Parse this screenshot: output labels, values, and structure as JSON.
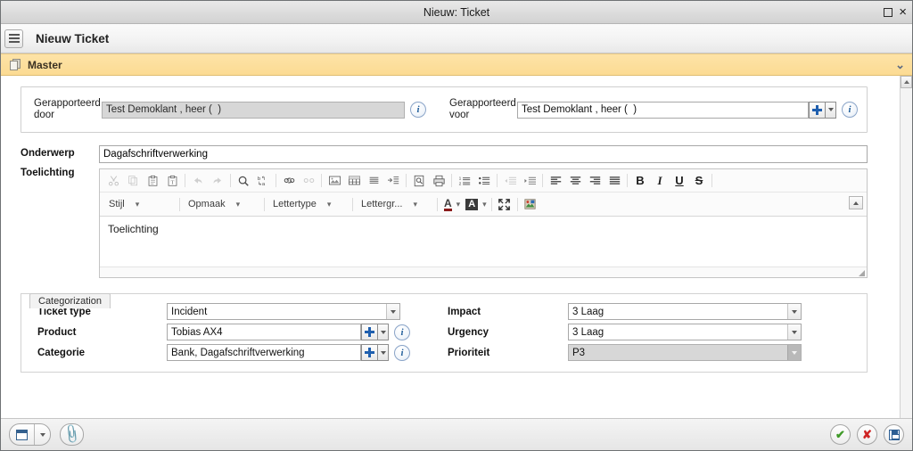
{
  "window": {
    "title": "Nieuw: Ticket",
    "maximize_label": "Maximize",
    "close_label": "×"
  },
  "header": {
    "menu_label": "Menu",
    "title": "Nieuw Ticket"
  },
  "master_section": {
    "label": "Master",
    "icon": "document-icon",
    "chevron": "⌄"
  },
  "reporter": {
    "by": {
      "label_line1": "Gerapporteerd",
      "label_line2": "door",
      "value": "Test Demoklant , heer (  )",
      "disabled": true,
      "info_label": "i"
    },
    "for": {
      "label_line1": "Gerapporteerd",
      "label_line2": "voor",
      "value": "Test Demoklant , heer (  )",
      "disabled": false,
      "info_label": "i"
    }
  },
  "subject": {
    "label": "Onderwerp",
    "value": "Dagafschriftverwerking"
  },
  "description": {
    "label": "Toelichting",
    "body_text": "Toelichting",
    "toolbar_row1": [
      {
        "name": "cut-icon",
        "glyph": "✂",
        "disabled": true
      },
      {
        "name": "copy-icon",
        "glyph": "⧉",
        "disabled": true
      },
      {
        "name": "paste-icon",
        "glyph": "📋",
        "disabled": false
      },
      {
        "name": "paste-from-word-icon",
        "glyph": "📋",
        "disabled": false
      },
      {
        "name": "separator",
        "glyph": "|",
        "disabled": false
      },
      {
        "name": "undo-icon",
        "glyph": "↩",
        "disabled": true
      },
      {
        "name": "redo-icon",
        "glyph": "↪",
        "disabled": true
      },
      {
        "name": "separator",
        "glyph": "|",
        "disabled": false
      },
      {
        "name": "find-icon",
        "glyph": "🔍",
        "disabled": false
      },
      {
        "name": "replace-icon",
        "glyph": "ab",
        "disabled": false
      },
      {
        "name": "separator",
        "glyph": "|",
        "disabled": false
      },
      {
        "name": "link-icon",
        "glyph": "🔗",
        "disabled": false
      },
      {
        "name": "unlink-icon",
        "glyph": "🔗",
        "disabled": true
      },
      {
        "name": "separator",
        "glyph": "|",
        "disabled": false
      },
      {
        "name": "image-icon",
        "glyph": "🖼",
        "disabled": false
      },
      {
        "name": "table-icon",
        "glyph": "▦",
        "disabled": false
      },
      {
        "name": "horizontal-rule-icon",
        "glyph": "▤",
        "disabled": false
      },
      {
        "name": "page-break-icon",
        "glyph": "⇥",
        "disabled": false
      },
      {
        "name": "separator",
        "glyph": "|",
        "disabled": false
      },
      {
        "name": "preview-icon",
        "glyph": "🗎",
        "disabled": false
      },
      {
        "name": "print-icon",
        "glyph": "🖶",
        "disabled": false
      },
      {
        "name": "separator",
        "glyph": "|",
        "disabled": false
      },
      {
        "name": "numbered-list-icon",
        "glyph": "1≡",
        "disabled": false
      },
      {
        "name": "bulleted-list-icon",
        "glyph": "•≡",
        "disabled": false
      },
      {
        "name": "separator",
        "glyph": "|",
        "disabled": false
      },
      {
        "name": "decrease-indent-icon",
        "glyph": "⇤",
        "disabled": true
      },
      {
        "name": "increase-indent-icon",
        "glyph": "⇥",
        "disabled": false
      },
      {
        "name": "separator",
        "glyph": "|",
        "disabled": false
      },
      {
        "name": "align-left-icon",
        "glyph": "≡",
        "disabled": false
      },
      {
        "name": "align-center-icon",
        "glyph": "≡",
        "disabled": false
      },
      {
        "name": "align-right-icon",
        "glyph": "≡",
        "disabled": false
      },
      {
        "name": "justify-icon",
        "glyph": "≡",
        "disabled": false
      },
      {
        "name": "separator",
        "glyph": "|",
        "disabled": false
      },
      {
        "name": "bold-icon",
        "glyph": "B",
        "disabled": false
      },
      {
        "name": "italic-icon",
        "glyph": "I",
        "disabled": false
      },
      {
        "name": "underline-icon",
        "glyph": "U",
        "disabled": false
      },
      {
        "name": "strikethrough-icon",
        "glyph": "S",
        "disabled": false
      }
    ],
    "toolbar_row2": {
      "style_dropdown": "Stijl",
      "format_dropdown": "Opmaak",
      "fontname_dropdown": "Lettertype",
      "fontsize_dropdown": "Lettergr...",
      "text_color_label": "A",
      "bg_color_label": "A",
      "maximize_label": "maximize-editor-icon",
      "emoticon_label": "image-button-icon",
      "collapse_toolbar_label": "collapse-toolbar-icon"
    }
  },
  "categorization": {
    "tab_label": "Categorization",
    "left_fields": [
      {
        "label": "Ticket type",
        "value": "Incident",
        "type": "select",
        "disabled": false,
        "has_buttons": false
      },
      {
        "label": "Product",
        "value": "Tobias AX4",
        "type": "lookup",
        "disabled": false,
        "has_buttons": true
      },
      {
        "label": "Categorie",
        "value": "Bank, Dagafschriftverwerking",
        "type": "lookup",
        "disabled": false,
        "has_buttons": true
      }
    ],
    "right_fields": [
      {
        "label": "Impact",
        "value": "3 Laag",
        "type": "select",
        "disabled": false
      },
      {
        "label": "Urgency",
        "value": "3 Laag",
        "type": "select",
        "disabled": false
      },
      {
        "label": "Prioriteit",
        "value": "P3",
        "type": "select",
        "disabled": true
      }
    ]
  },
  "statusbar": {
    "form_button": "form-view-button",
    "form_dropdown": "form-view-dropdown",
    "attachment_button": "attachment-button",
    "ok_label": "✔",
    "cancel_label": "✘",
    "save_label": "save-button"
  },
  "colors": {
    "master_bar": "#fcdb93",
    "accent_blue": "#1f5fae",
    "ok_green": "#3f9a28",
    "cancel_red": "#cf2525",
    "disabled_field": "#d7d7d7"
  }
}
